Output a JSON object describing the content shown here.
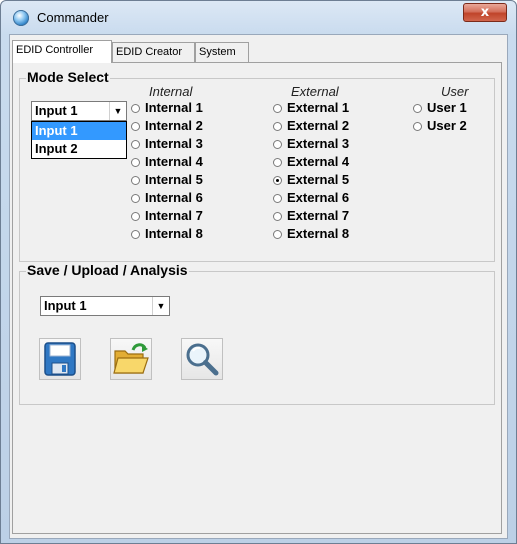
{
  "window": {
    "title": "Commander",
    "close_glyph": "x",
    "app_icon": "globe-icon"
  },
  "tabs": [
    {
      "label": "EDID Controller",
      "active": true
    },
    {
      "label": "EDID Creator",
      "active": false
    },
    {
      "label": "System",
      "active": false
    }
  ],
  "mode_select": {
    "label": "Mode Select",
    "input_combo": {
      "value": "Input 1",
      "options": [
        "Input 1",
        "Input 2"
      ],
      "highlighted": "Input 1"
    },
    "columns": [
      {
        "header": "Internal",
        "options": [
          "Internal 1",
          "Internal 2",
          "Internal 3",
          "Internal 4",
          "Internal 5",
          "Internal 6",
          "Internal 7",
          "Internal 8"
        ],
        "checked": null
      },
      {
        "header": "External",
        "options": [
          "External 1",
          "External 2",
          "External 3",
          "External 4",
          "External 5",
          "External 6",
          "External 7",
          "External 8"
        ],
        "checked": "External 5"
      },
      {
        "header": "User",
        "options": [
          "User 1",
          "User 2"
        ],
        "checked": null
      }
    ]
  },
  "save_upload": {
    "label": "Save / Upload / Analysis",
    "input_combo": {
      "value": "Input 1"
    },
    "buttons": [
      {
        "icon": "save-icon"
      },
      {
        "icon": "open-folder-icon"
      },
      {
        "icon": "magnifier-icon"
      }
    ]
  },
  "colors": {
    "selection": "#3399ff",
    "close_button": "#c0442a",
    "floppy_blue": "#2f78c4",
    "folder_yellow": "#f2c94c",
    "refresh_green": "#2f9a3a"
  }
}
